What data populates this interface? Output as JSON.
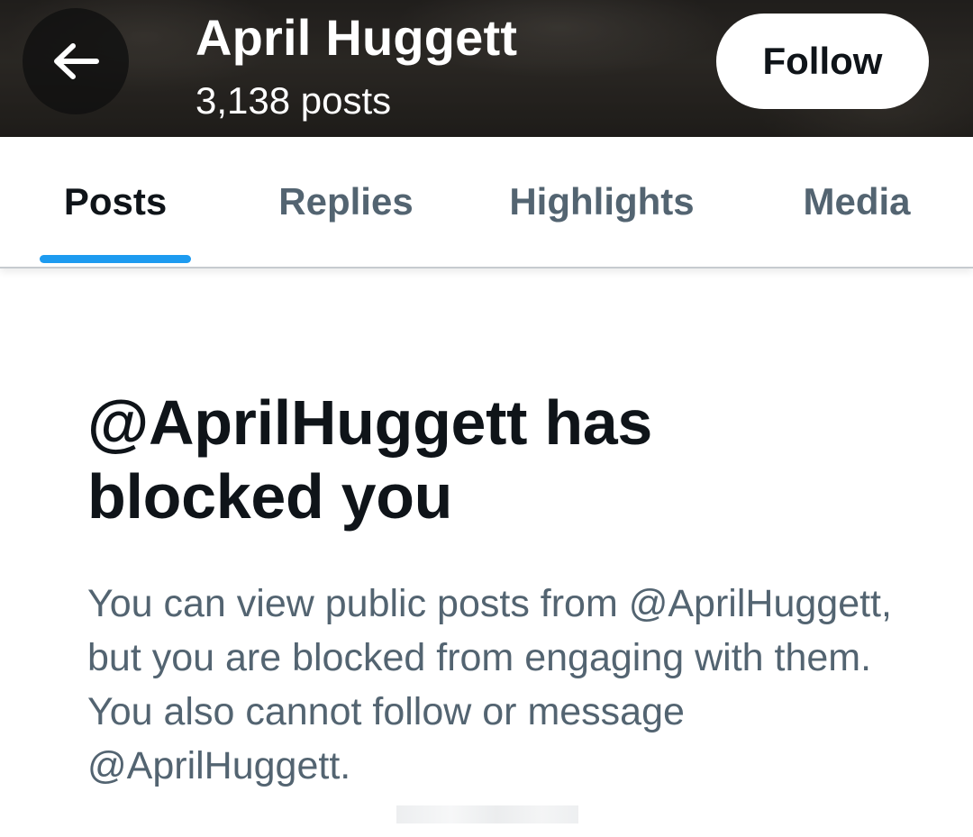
{
  "header": {
    "profile_name": "April Huggett",
    "post_count": "3,138 posts",
    "follow_label": "Follow"
  },
  "tabs": [
    {
      "label": "Posts",
      "active": true
    },
    {
      "label": "Replies",
      "active": false
    },
    {
      "label": "Highlights",
      "active": false
    },
    {
      "label": "Media",
      "active": false
    }
  ],
  "blocked_notice": {
    "title": "@AprilHuggett has blocked you",
    "message": "You can view public posts from @AprilHuggett, but you are blocked from engaging with them. You also cannot follow or message @AprilHuggett."
  },
  "icons": {
    "back": "arrow-left-icon"
  },
  "colors": {
    "accent": "#1d9bf0",
    "text_primary": "#0f1419",
    "text_secondary": "#536471",
    "follow_bg": "#ffffff"
  }
}
